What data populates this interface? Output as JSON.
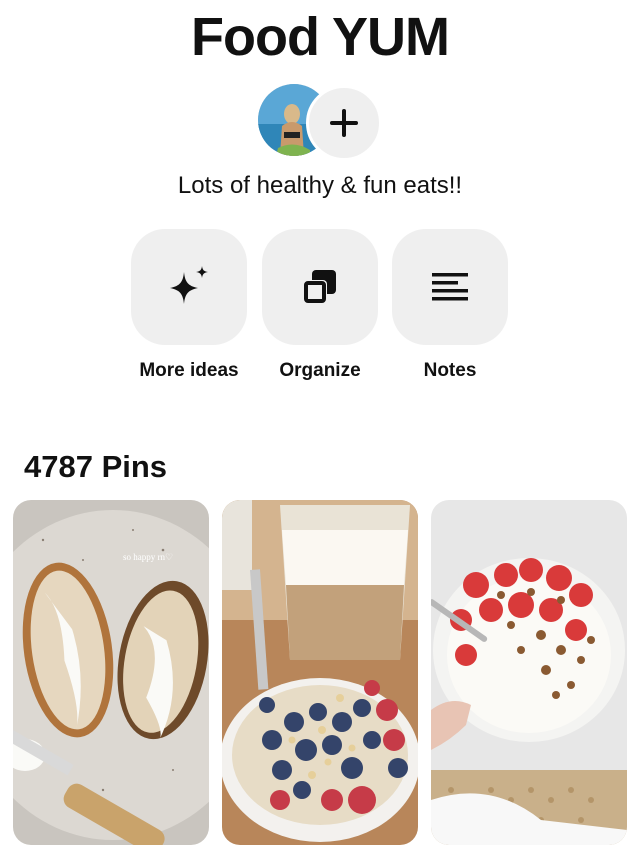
{
  "board": {
    "title": "Food YUM",
    "description": "Lots of healthy & fun eats!!"
  },
  "collaborators": {
    "avatar_icon": "user-avatar",
    "add_icon": "plus-icon"
  },
  "actions": [
    {
      "label": "More ideas",
      "icon": "sparkle-icon"
    },
    {
      "label": "Organize",
      "icon": "organize-icon"
    },
    {
      "label": "Notes",
      "icon": "notes-icon"
    }
  ],
  "pins": {
    "count_label": "4787 Pins",
    "items": [
      {
        "overlay_text": "so happy rn♡"
      },
      {
        "overlay_text": ""
      },
      {
        "overlay_text": ""
      }
    ]
  }
}
